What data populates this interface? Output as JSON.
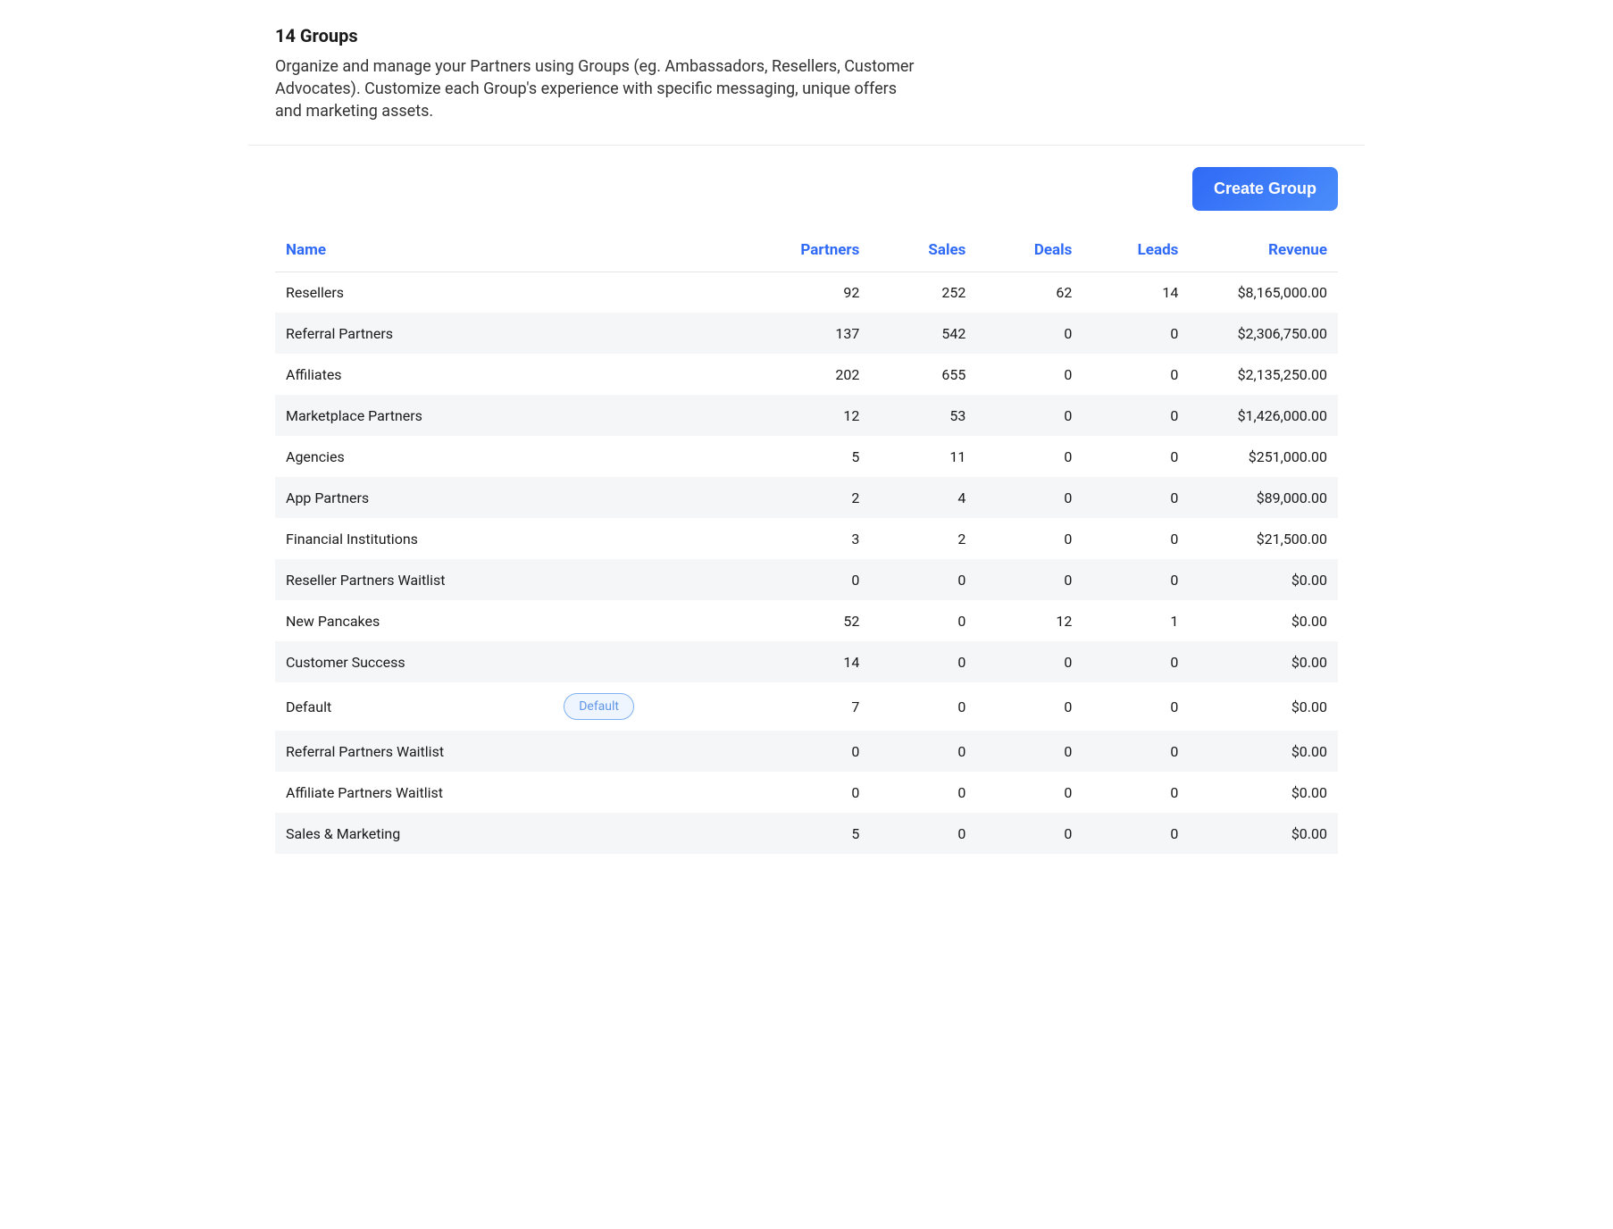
{
  "header": {
    "title": "14 Groups",
    "description": "Organize and manage your Partners using Groups (eg. Ambassadors, Resellers, Customer Advocates). Customize each Group's experience with specific messaging, unique offers and marketing assets."
  },
  "actions": {
    "create_group_label": "Create Group"
  },
  "table": {
    "columns": {
      "name": "Name",
      "partners": "Partners",
      "sales": "Sales",
      "deals": "Deals",
      "leads": "Leads",
      "revenue": "Revenue"
    },
    "default_badge": "Default",
    "rows": [
      {
        "name": "Resellers",
        "partners": "92",
        "sales": "252",
        "deals": "62",
        "leads": "14",
        "revenue": "$8,165,000.00",
        "is_default": false
      },
      {
        "name": "Referral Partners",
        "partners": "137",
        "sales": "542",
        "deals": "0",
        "leads": "0",
        "revenue": "$2,306,750.00",
        "is_default": false
      },
      {
        "name": "Affiliates",
        "partners": "202",
        "sales": "655",
        "deals": "0",
        "leads": "0",
        "revenue": "$2,135,250.00",
        "is_default": false
      },
      {
        "name": "Marketplace Partners",
        "partners": "12",
        "sales": "53",
        "deals": "0",
        "leads": "0",
        "revenue": "$1,426,000.00",
        "is_default": false
      },
      {
        "name": "Agencies",
        "partners": "5",
        "sales": "11",
        "deals": "0",
        "leads": "0",
        "revenue": "$251,000.00",
        "is_default": false
      },
      {
        "name": "App Partners",
        "partners": "2",
        "sales": "4",
        "deals": "0",
        "leads": "0",
        "revenue": "$89,000.00",
        "is_default": false
      },
      {
        "name": "Financial Institutions",
        "partners": "3",
        "sales": "2",
        "deals": "0",
        "leads": "0",
        "revenue": "$21,500.00",
        "is_default": false
      },
      {
        "name": "Reseller Partners Waitlist",
        "partners": "0",
        "sales": "0",
        "deals": "0",
        "leads": "0",
        "revenue": "$0.00",
        "is_default": false
      },
      {
        "name": "New Pancakes",
        "partners": "52",
        "sales": "0",
        "deals": "12",
        "leads": "1",
        "revenue": "$0.00",
        "is_default": false
      },
      {
        "name": "Customer Success",
        "partners": "14",
        "sales": "0",
        "deals": "0",
        "leads": "0",
        "revenue": "$0.00",
        "is_default": false
      },
      {
        "name": "Default",
        "partners": "7",
        "sales": "0",
        "deals": "0",
        "leads": "0",
        "revenue": "$0.00",
        "is_default": true
      },
      {
        "name": "Referral Partners Waitlist",
        "partners": "0",
        "sales": "0",
        "deals": "0",
        "leads": "0",
        "revenue": "$0.00",
        "is_default": false
      },
      {
        "name": "Affiliate Partners Waitlist",
        "partners": "0",
        "sales": "0",
        "deals": "0",
        "leads": "0",
        "revenue": "$0.00",
        "is_default": false
      },
      {
        "name": "Sales & Marketing",
        "partners": "5",
        "sales": "0",
        "deals": "0",
        "leads": "0",
        "revenue": "$0.00",
        "is_default": false
      }
    ]
  }
}
